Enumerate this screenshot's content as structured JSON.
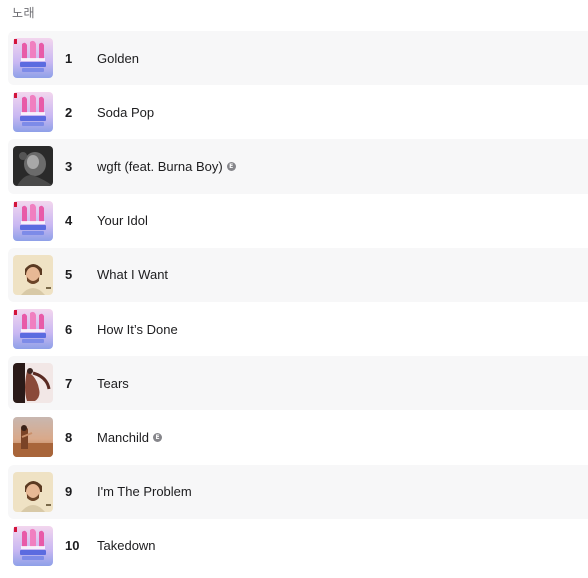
{
  "section": {
    "title": "노래"
  },
  "songs": [
    {
      "rank": "1",
      "title": "Golden",
      "explicit": false,
      "artwork": "kpop-demon-hunters-cover"
    },
    {
      "rank": "2",
      "title": "Soda Pop",
      "explicit": false,
      "artwork": "kpop-demon-hunters-cover"
    },
    {
      "rank": "3",
      "title": "wgft (feat. Burna Boy)",
      "explicit": true,
      "artwork": "dark-portrait-cover"
    },
    {
      "rank": "4",
      "title": "Your Idol",
      "explicit": false,
      "artwork": "kpop-demon-hunters-cover"
    },
    {
      "rank": "5",
      "title": "What I Want",
      "explicit": false,
      "artwork": "man-portrait-cover"
    },
    {
      "rank": "6",
      "title": "How It’s Done",
      "explicit": false,
      "artwork": "kpop-demon-hunters-cover"
    },
    {
      "rank": "7",
      "title": "Tears",
      "explicit": false,
      "artwork": "dancer-cover"
    },
    {
      "rank": "8",
      "title": "Manchild",
      "explicit": true,
      "artwork": "desert-cover"
    },
    {
      "rank": "9",
      "title": "I'm The Problem",
      "explicit": false,
      "artwork": "man-portrait-cover"
    },
    {
      "rank": "10",
      "title": "Takedown",
      "explicit": false,
      "artwork": "kpop-demon-hunters-cover"
    }
  ],
  "explicit_badge": {
    "glyph": "E",
    "icon": "explicit-icon"
  },
  "colors": {
    "row_alt": "#f7f7f8",
    "text": "#1d1d1f",
    "muted": "#6e6e73"
  }
}
